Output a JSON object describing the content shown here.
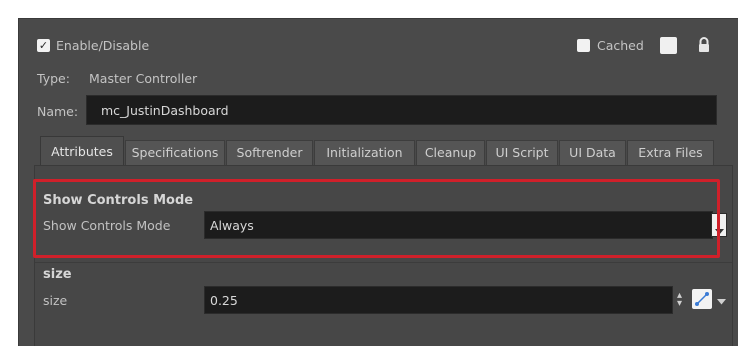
{
  "header": {
    "enable_label": "Enable/Disable",
    "enable_checked": true,
    "cached_label": "Cached",
    "cached_checked": false,
    "lock_icon": "lock-icon",
    "type_label": "Type:",
    "type_value": "Master Controller",
    "name_label": "Name:",
    "name_value": "mc_JustinDashboard"
  },
  "tabs": [
    {
      "label": "Attributes",
      "active": true
    },
    {
      "label": "Specifications"
    },
    {
      "label": "Softrender"
    },
    {
      "label": "Initialization"
    },
    {
      "label": "Cleanup"
    },
    {
      "label": "UI Script"
    },
    {
      "label": "UI Data"
    },
    {
      "label": "Extra Files"
    }
  ],
  "show_controls": {
    "group_title": "Show Controls Mode",
    "field_label": "Show Controls Mode",
    "value": "Always"
  },
  "size": {
    "group_title": "size",
    "field_label": "size",
    "value": "0.25"
  },
  "colors": {
    "panel_bg": "#4a4a4a",
    "field_bg": "#1c1c1c",
    "highlight": "#d0202a"
  }
}
